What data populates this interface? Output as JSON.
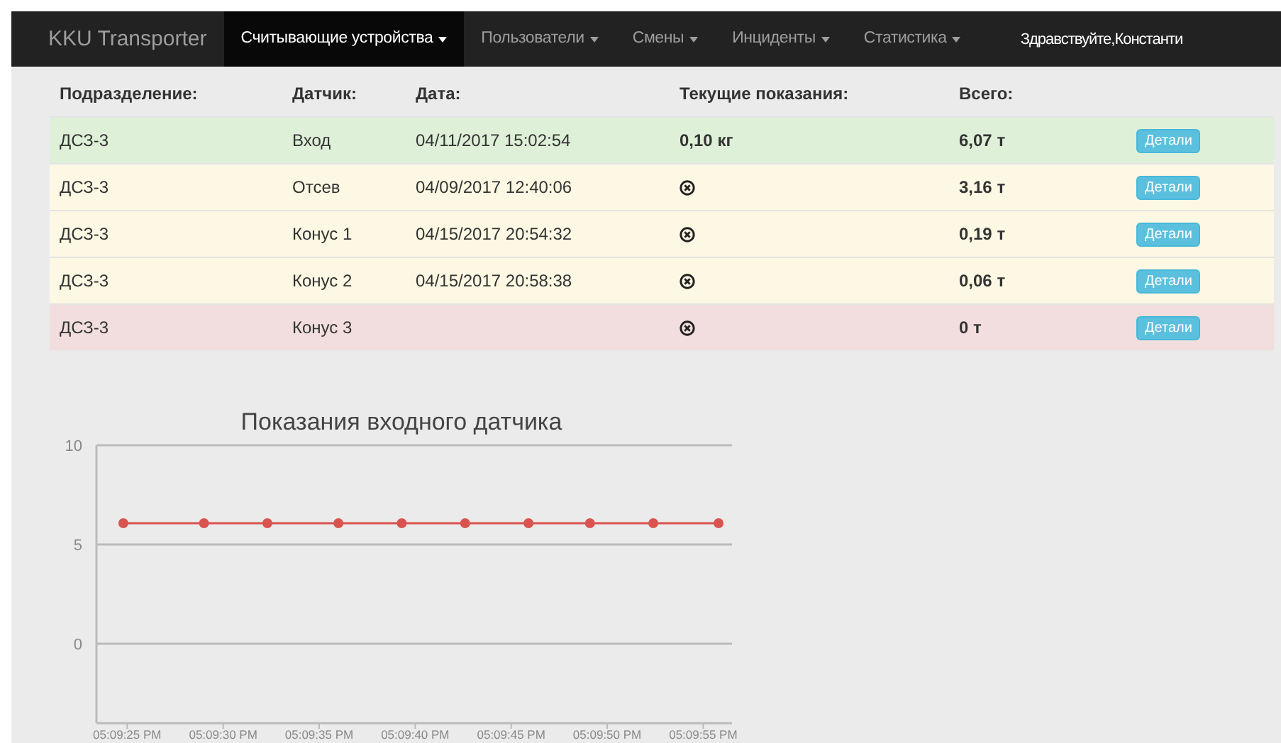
{
  "navbar": {
    "brand": "KKU Transporter",
    "items": [
      {
        "label": "Считывающие устройства",
        "selected": true
      },
      {
        "label": "Пользователи",
        "selected": false
      },
      {
        "label": "Смены",
        "selected": false
      },
      {
        "label": "Инциденты",
        "selected": false
      },
      {
        "label": "Статистика",
        "selected": false
      }
    ],
    "greeting": "Здравствуйте,Константи"
  },
  "table": {
    "columns": [
      "Подразделение:",
      "Датчик:",
      "Дата:",
      "Текущие показания:",
      "Всего:"
    ],
    "rows": [
      {
        "color": "#dff0d8",
        "unit": "ДСЗ-3",
        "sensor": "Вход",
        "date": "04/11/2017 15:02:54",
        "reading": {
          "kind": "text",
          "text": "0,10 кг"
        },
        "total": "6,07 т",
        "button": "Детали"
      },
      {
        "color": "#fcf8e3",
        "unit": "ДСЗ-3",
        "sensor": "Отсев",
        "date": "04/09/2017 12:40:06",
        "reading": {
          "kind": "error"
        },
        "total": "3,16 т",
        "button": "Детали"
      },
      {
        "color": "#fcf8e3",
        "unit": "ДСЗ-3",
        "sensor": "Конус 1",
        "date": "04/15/2017 20:54:32",
        "reading": {
          "kind": "error"
        },
        "total": "0,19 т",
        "button": "Детали"
      },
      {
        "color": "#fcf8e3",
        "unit": "ДСЗ-3",
        "sensor": "Конус 2",
        "date": "04/15/2017 20:58:38",
        "reading": {
          "kind": "error"
        },
        "total": "0,06 т",
        "button": "Детали"
      },
      {
        "color": "#f2dede",
        "unit": "ДСЗ-3",
        "sensor": "Конус 3",
        "reading": {
          "kind": "error"
        },
        "total": "0 т",
        "button": "Детали"
      }
    ]
  },
  "chart_data": {
    "type": "line",
    "title": "Показания входного датчика",
    "x": [
      61764.8,
      61769.0,
      61772.3,
      61776.0,
      61779.3,
      61782.6,
      61785.9,
      61789.1,
      61792.4,
      61795.8
    ],
    "series": [
      {
        "marker": "circle",
        "color": "#d9534f",
        "values": [
          6.07,
          6.07,
          6.07,
          6.07,
          6.07,
          6.07,
          6.07,
          6.07,
          6.07,
          6.07
        ]
      }
    ],
    "xlim": [
      61763.4,
      61796.5
    ],
    "ylim": [
      -4,
      10
    ],
    "yticks": [
      0,
      5,
      10
    ],
    "xticks": [
      {
        "value": 61765,
        "label": "05:09:25 PM"
      },
      {
        "value": 61770,
        "label": "05:09:30 PM"
      },
      {
        "value": 61775,
        "label": "05:09:35 PM"
      },
      {
        "value": 61780,
        "label": "05:09:40 PM"
      },
      {
        "value": 61785,
        "label": "05:09:45 PM"
      },
      {
        "value": 61790,
        "label": "05:09:50 PM"
      },
      {
        "value": 61795,
        "label": "05:09:55 PM"
      }
    ]
  }
}
